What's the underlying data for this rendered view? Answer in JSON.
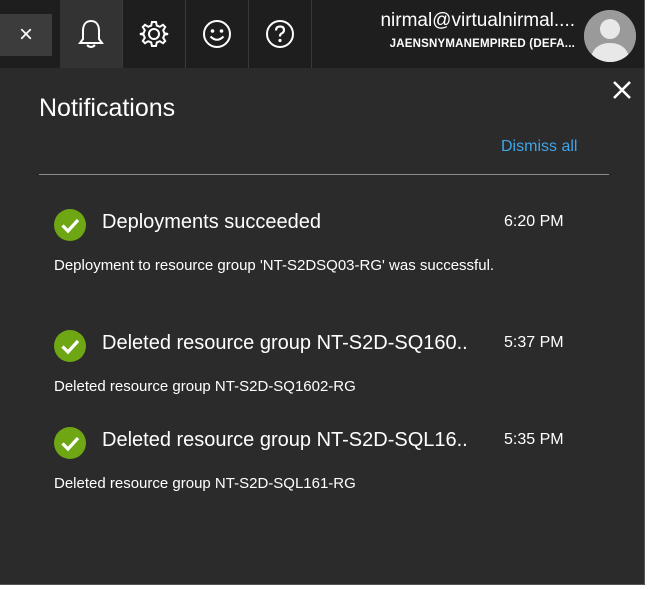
{
  "topbar": {
    "close_label": "×",
    "icons": {
      "bell": "bell-icon",
      "settings": "gear-icon",
      "feedback": "smiley-icon",
      "help": "help-icon"
    }
  },
  "user": {
    "name": "nirmal@virtualnirmal....",
    "directory": "JAENSNYMANEMPIRED (DEFA..."
  },
  "panel": {
    "title": "Notifications",
    "dismiss_all": "Dismiss all",
    "close_icon": "close-icon"
  },
  "colors": {
    "success": "#6ea614",
    "link": "#3ea5e8",
    "panel_bg": "#2b2b2b",
    "topbar_bg": "#1e1e1e"
  },
  "notifications": [
    {
      "title": "Deployments succeeded",
      "time": "6:20 PM",
      "description": "Deployment to resource group 'NT-S2DSQ03-RG' was successful.",
      "status": "success"
    },
    {
      "title": "Deleted resource group NT-S2D-SQ160..",
      "time": "5:37 PM",
      "description": "Deleted resource group NT-S2D-SQ1602-RG",
      "status": "success"
    },
    {
      "title": "Deleted resource group NT-S2D-SQL16..",
      "time": "5:35 PM",
      "description": "Deleted resource group NT-S2D-SQL161-RG",
      "status": "success"
    }
  ]
}
